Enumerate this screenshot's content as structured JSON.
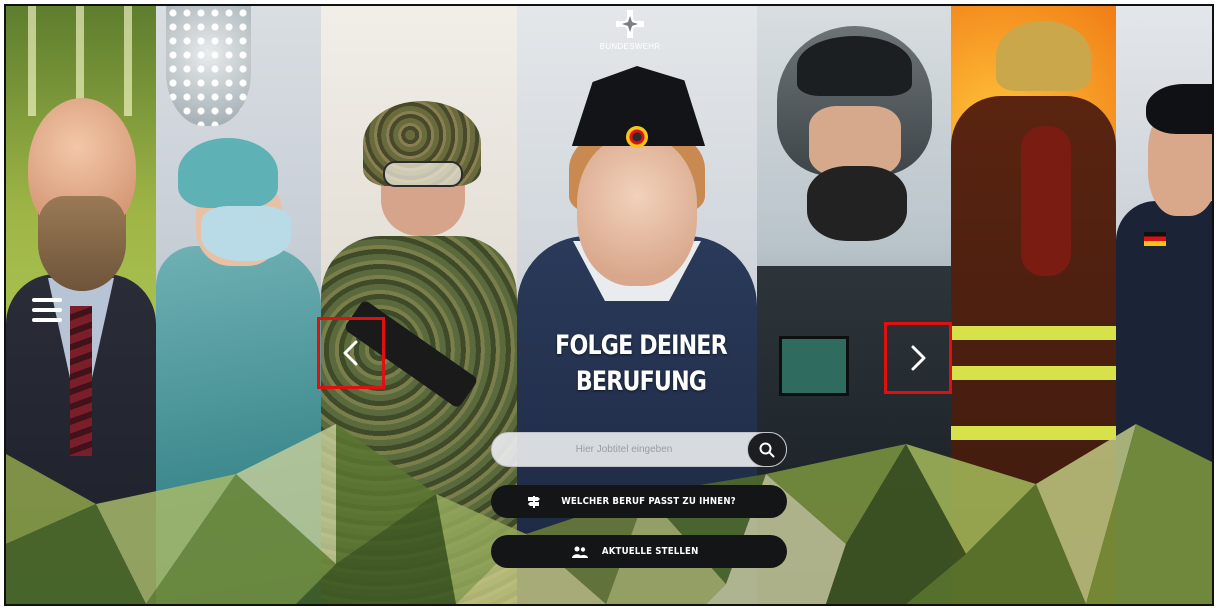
{
  "logo": {
    "text": "BUNDESWEHR",
    "icon": "iron-cross-icon"
  },
  "menu": {
    "icon": "hamburger-menu-icon"
  },
  "carousel": {
    "prev_icon": "chevron-left-icon",
    "next_icon": "chevron-right-icon",
    "highlight_color": "#e01010"
  },
  "hero": {
    "line1": "FOLGE DEINER",
    "line2": "BERUFUNG"
  },
  "search": {
    "placeholder": "Hier Jobtitel eingeben",
    "value": "",
    "icon": "search-icon"
  },
  "buttons": {
    "career_quiz": {
      "label": "WELCHER BERUF PASST ZU IHNEN?",
      "icon": "signpost-icon"
    },
    "jobs": {
      "label": "AKTUELLE STELLEN",
      "icon": "people-icon"
    }
  },
  "colors": {
    "button_bg": "#141517",
    "button_text": "#ffffff",
    "headline": "#ffffff"
  }
}
